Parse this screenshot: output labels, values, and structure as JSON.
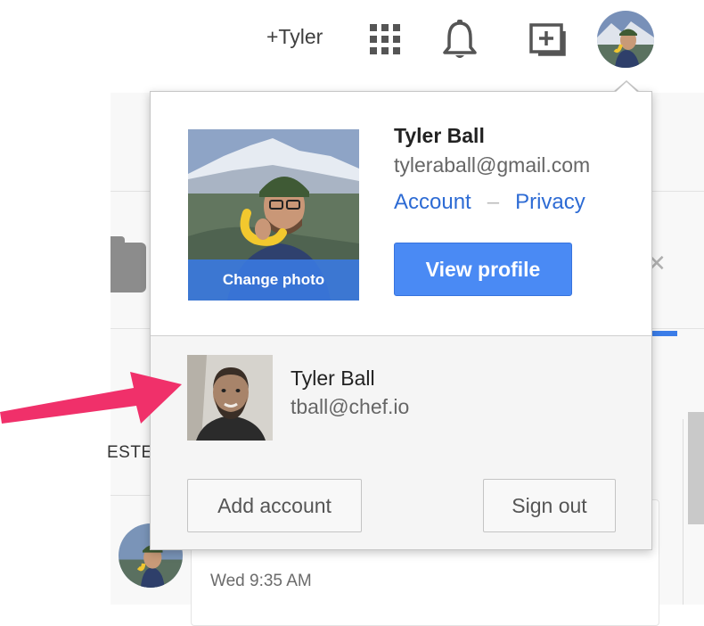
{
  "topbar": {
    "user_link": "+Tyler",
    "icons": [
      "apps-grid-icon",
      "notifications-bell-icon",
      "share-add-icon",
      "avatar"
    ]
  },
  "popup": {
    "main_account": {
      "name": "Tyler Ball",
      "email": "tyleraball@gmail.com",
      "change_photo_label": "Change photo",
      "account_link": "Account",
      "separator": "–",
      "privacy_link": "Privacy",
      "view_profile_label": "View profile"
    },
    "other_account": {
      "name": "Tyler Ball",
      "email": "tball@chef.io"
    },
    "footer": {
      "add_account_label": "Add account",
      "sign_out_label": "Sign out"
    }
  },
  "background": {
    "partial_label": "ESTE",
    "timestamp": "Wed 9:35 AM"
  },
  "colors": {
    "accent_blue": "#4a8af4",
    "link_blue": "#2d6bd4",
    "arrow_pink": "#f0306a"
  }
}
